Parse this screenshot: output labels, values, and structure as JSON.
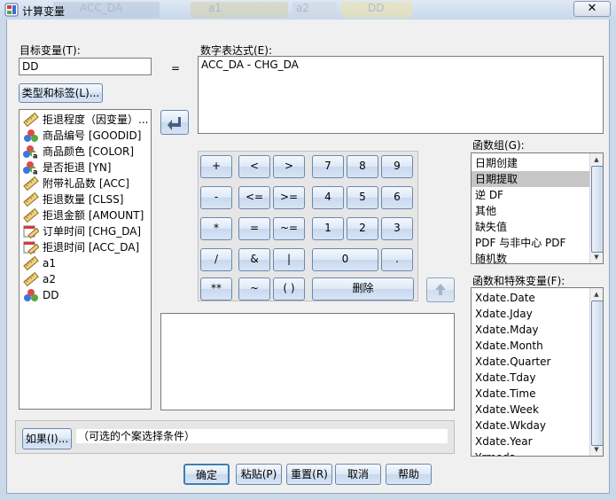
{
  "window": {
    "title": "计算变量",
    "close": "✕"
  },
  "background_tabs": [
    "ACC_DA",
    "a1",
    "a2",
    "DD"
  ],
  "target": {
    "label": "目标变量(T):",
    "value": "DD",
    "equals": "=",
    "type_button": "类型和标签(L)..."
  },
  "expression": {
    "label": "数字表达式(E):",
    "value": "ACC_DA - CHG_DA"
  },
  "variables": [
    {
      "label": "拒退程度（因变量）...",
      "icon": "ruler-icon"
    },
    {
      "label": "商品编号 [GOODID]",
      "icon": "nominal-icon"
    },
    {
      "label": "商品颜色 [COLOR]",
      "icon": "nominal-string-icon"
    },
    {
      "label": "是否拒退 [YN]",
      "icon": "nominal-string-icon"
    },
    {
      "label": "附带礼品数 [ACC]",
      "icon": "ruler-icon"
    },
    {
      "label": "拒退数量 [CLSS]",
      "icon": "ruler-icon"
    },
    {
      "label": "拒退金额 [AMOUNT]",
      "icon": "ruler-icon"
    },
    {
      "label": "订单时间 [CHG_DA]",
      "icon": "date-icon"
    },
    {
      "label": "拒退时间 [ACC_DA]",
      "icon": "date-icon"
    },
    {
      "label": "a1",
      "icon": "ruler-icon"
    },
    {
      "label": "a2",
      "icon": "ruler-icon"
    },
    {
      "label": "DD",
      "icon": "nominal-icon"
    }
  ],
  "keypad": {
    "row1": [
      "+",
      "<",
      ">",
      "7",
      "8",
      "9"
    ],
    "row2": [
      "-",
      "<=",
      ">=",
      "4",
      "5",
      "6"
    ],
    "row3": [
      "*",
      "=",
      "~=",
      "1",
      "2",
      "3"
    ],
    "row4": [
      "/",
      "&",
      "|",
      "0",
      "."
    ],
    "row5": [
      "**",
      "~",
      "( )",
      "删除"
    ]
  },
  "function_groups": {
    "label": "函数组(G):",
    "items": [
      "日期创建",
      "日期提取",
      "逆 DF",
      "其他",
      "缺失值",
      "PDF 与非中心 PDF",
      "随机数"
    ],
    "selected_index": 1
  },
  "functions": {
    "label": "函数和特殊变量(F):",
    "items": [
      "Xdate.Date",
      "Xdate.Jday",
      "Xdate.Mday",
      "Xdate.Month",
      "Xdate.Quarter",
      "Xdate.Tday",
      "Xdate.Time",
      "Xdate.Week",
      "Xdate.Wkday",
      "Xdate.Year",
      "Yrmoda"
    ]
  },
  "if_condition": {
    "button": "如果(I)...",
    "text": "（可选的个案选择条件）"
  },
  "buttons": {
    "ok": "确定",
    "paste": "粘贴(P)",
    "reset": "重置(R)",
    "cancel": "取消",
    "help": "帮助"
  },
  "colors": {
    "title_bg": "#c7d8ec",
    "dialog_bg": "#f0f0f0",
    "selection": "#c6c6c6",
    "button_border": "#6c87ad"
  }
}
